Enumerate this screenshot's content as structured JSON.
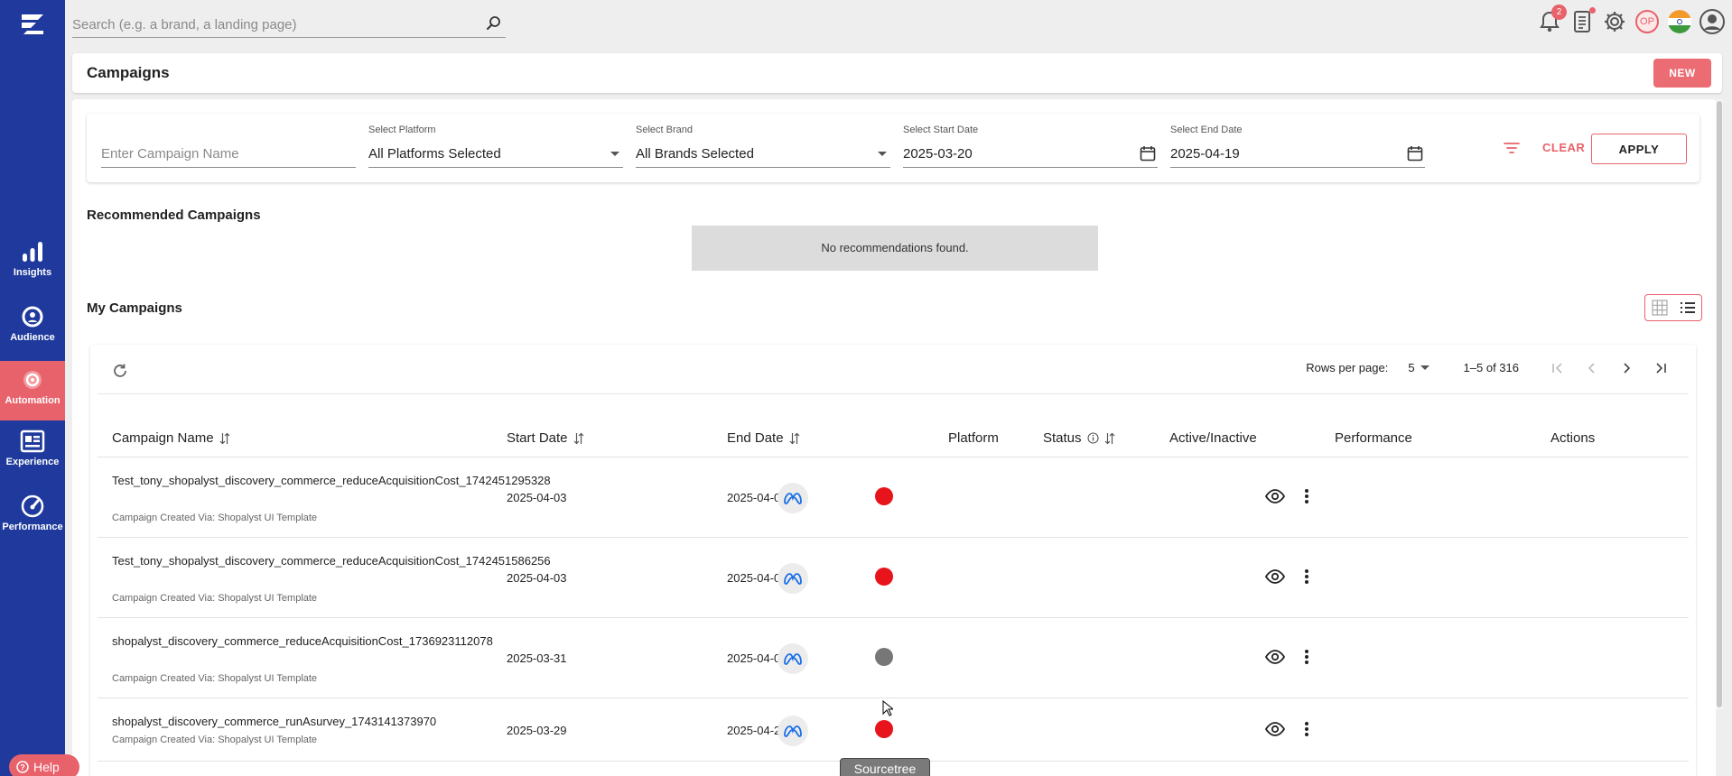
{
  "topbar": {
    "search_placeholder": "Search (e.g. a brand, a landing page)",
    "notification_count": "2",
    "profile_initials": "OP"
  },
  "sidebar": {
    "items": [
      {
        "label": "Insights",
        "icon": "bar-chart-icon"
      },
      {
        "label": "Audience",
        "icon": "target-icon"
      },
      {
        "label": "Automation",
        "icon": "gear-icon",
        "active": true
      },
      {
        "label": "Experience",
        "icon": "layout-icon"
      },
      {
        "label": "Performance",
        "icon": "gauge-icon"
      }
    ],
    "help_label": "Help"
  },
  "header": {
    "title": "Campaigns",
    "new_label": "NEW"
  },
  "filters": {
    "campaign_name_placeholder": "Enter Campaign Name",
    "platform_label": "Select Platform",
    "platform_value": "All Platforms Selected",
    "brand_label": "Select Brand",
    "brand_value": "All Brands Selected",
    "start_label": "Select Start Date",
    "start_value": "2025-03-20",
    "end_label": "Select End Date",
    "end_value": "2025-04-19",
    "clear_label": "CLEAR",
    "apply_label": "APPLY"
  },
  "recommended": {
    "title": "Recommended Campaigns",
    "empty_text": "No recommendations found."
  },
  "my_campaigns": {
    "title": "My Campaigns",
    "rows_per_page_label": "Rows per page:",
    "rows_per_page_value": "5",
    "range_text": "1–5 of 316",
    "columns": [
      "Campaign Name",
      "Start Date",
      "End Date",
      "Platform",
      "Status",
      "Active/Inactive",
      "Performance",
      "Actions"
    ],
    "rows": [
      {
        "name": "Test_tony_shopalyst_discovery_commerce_reduceAcquisitionCost_1742451295328",
        "sub": "Campaign Created Via: Shopalyst UI Template",
        "start": "2025-04-03",
        "end": "2025-04-05",
        "platform": "meta",
        "status_color": "#e8141b"
      },
      {
        "name": "Test_tony_shopalyst_discovery_commerce_reduceAcquisitionCost_1742451586256",
        "sub": "Campaign Created Via: Shopalyst UI Template",
        "start": "2025-04-03",
        "end": "2025-04-05",
        "platform": "meta",
        "status_color": "#e8141b"
      },
      {
        "name": "shopalyst_discovery_commerce_reduceAcquisitionCost_1736923112078",
        "sub": "Campaign Created Via: Shopalyst UI Template",
        "start": "2025-03-31",
        "end": "2025-04-01",
        "platform": "meta",
        "status_color": "#777777"
      },
      {
        "name": "shopalyst_discovery_commerce_runAsurvey_1743141373970",
        "sub": "Campaign Created Via: Shopalyst UI Template",
        "start": "2025-03-29",
        "end": "2025-04-29",
        "platform": "meta",
        "status_color": "#e8141b"
      }
    ]
  },
  "tooltip": "Sourcetree",
  "colors": {
    "sidebar": "#1f3a9c",
    "accent": "#e8626b"
  }
}
